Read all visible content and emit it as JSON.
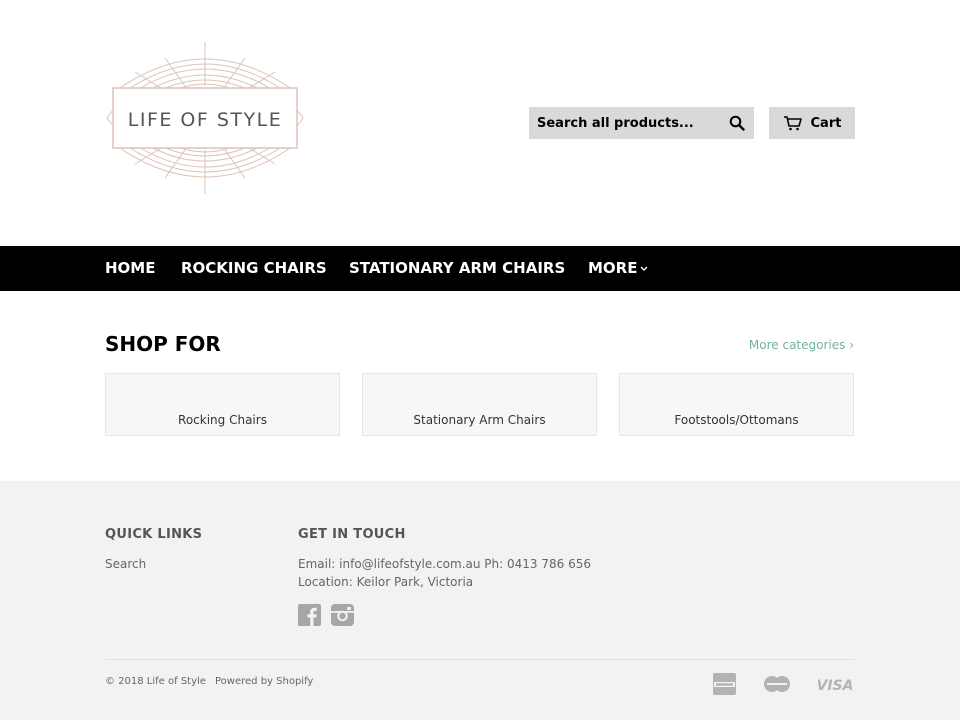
{
  "header": {
    "logo_text": "LIFE OF STYLE",
    "search_placeholder": "Search all products...",
    "cart_label": "Cart"
  },
  "nav": {
    "items": [
      {
        "label": "HOME"
      },
      {
        "label": "ROCKING CHAIRS"
      },
      {
        "label": "STATIONARY ARM CHAIRS"
      },
      {
        "label": "MORE"
      }
    ]
  },
  "main": {
    "section_title": "SHOP FOR",
    "more_categories": "More categories ›",
    "categories": [
      {
        "label": "Rocking Chairs"
      },
      {
        "label": "Stationary Arm Chairs"
      },
      {
        "label": "Footstools/Ottomans"
      }
    ]
  },
  "footer": {
    "quick_links_title": "QUICK LINKS",
    "quick_links": [
      "Search"
    ],
    "contact_title": "GET IN TOUCH",
    "contact_line1": "Email: info@lifeofstyle.com.au Ph: 0413 786 656",
    "contact_line2": "Location: Keilor Park, Victoria",
    "copyright": "© 2018 Life of Style",
    "powered": "Powered by Shopify",
    "payment_icons": [
      "american-express-icon",
      "mastercard-icon",
      "visa-icon"
    ]
  },
  "colors": {
    "nav_bg": "#000000",
    "accent_link": "#6fb49a",
    "button_bg": "#d9d9d9",
    "footer_bg": "#f2f2f2",
    "logo_tone": "#dcc3b8"
  }
}
